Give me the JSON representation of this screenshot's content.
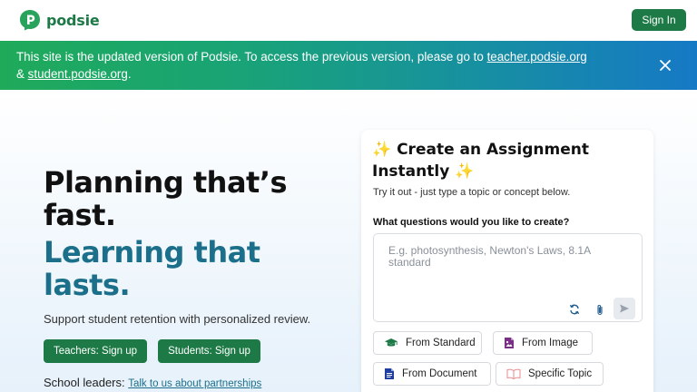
{
  "header": {
    "logo_text": "podsie",
    "signin_label": "Sign In",
    "brand_color": "#1d7a46"
  },
  "banner": {
    "text": "This site is the updated version of Podsie. To access the previous version, please go to ",
    "link1": "teacher.podsie.org",
    "amp": " & ",
    "link2": "student.podsie.org",
    "end": "."
  },
  "hero": {
    "headline": "Planning that’s fast.",
    "headline2": "Learning that lasts.",
    "subtext": "Support student retention with personalized review.",
    "teacher_cta": "Teachers: Sign up",
    "student_cta": "Students: Sign up",
    "leaders_prefix": "School leaders: ",
    "leaders_link": "Talk to us about partnerships"
  },
  "card": {
    "title": "✨ Create an Assignment Instantly ✨",
    "subtitle": "Try it out - just type a topic or concept below.",
    "question_label": "What questions would you like to create?",
    "placeholder": "E.g. photosynthesis, Newton's Laws, 8.1A standard",
    "chips": {
      "standard": "From Standard",
      "image": "From Image",
      "document": "From Document",
      "topic": "Specific Topic"
    }
  }
}
